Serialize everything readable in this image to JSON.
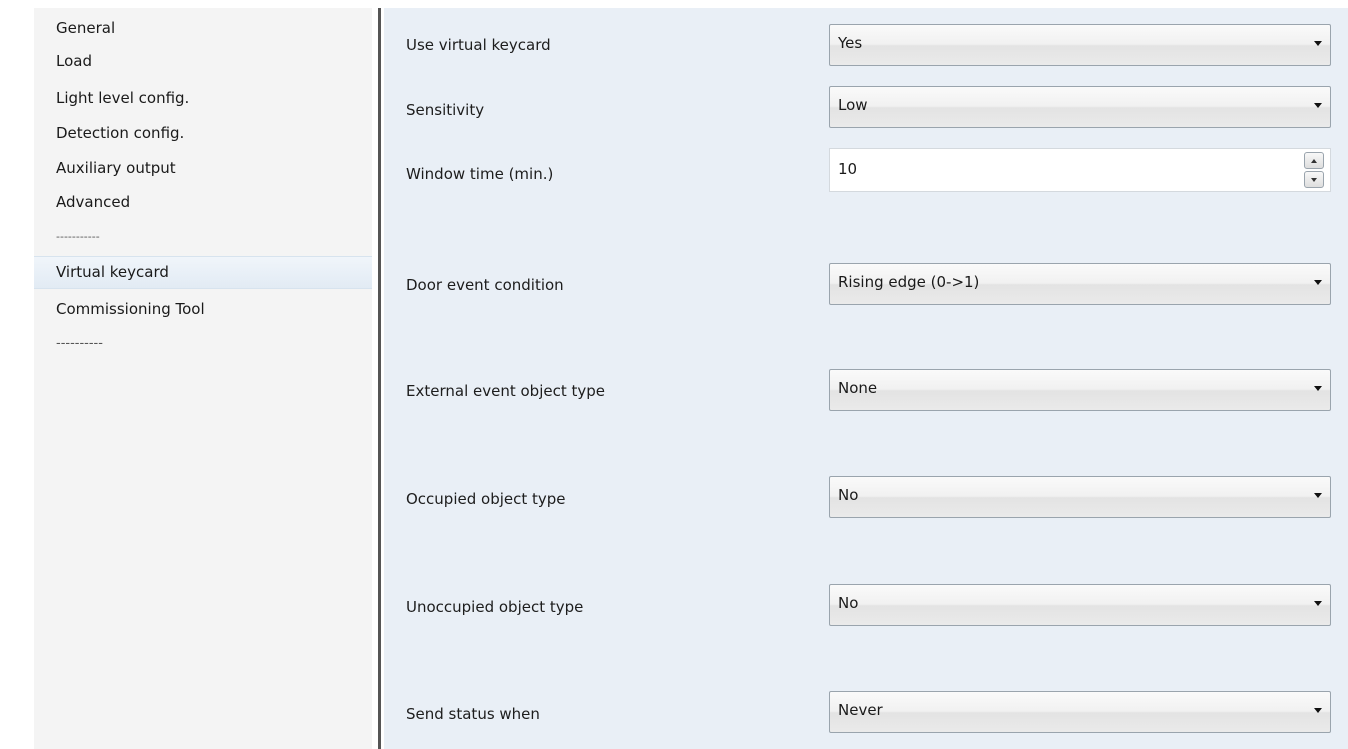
{
  "sidebar": {
    "items": [
      {
        "label": "General"
      },
      {
        "label": "Load"
      },
      {
        "label": "Light level config."
      },
      {
        "label": "Detection config."
      },
      {
        "label": "Auxiliary output"
      },
      {
        "label": "Advanced"
      },
      {
        "label": "-----------"
      },
      {
        "label": "Virtual keycard"
      },
      {
        "label": "Commissioning Tool"
      },
      {
        "label": "----------"
      }
    ],
    "selected_index": 7
  },
  "settings": {
    "use_virtual_keycard": {
      "label": "Use virtual keycard",
      "value": "Yes"
    },
    "sensitivity": {
      "label": "Sensitivity",
      "value": "Low"
    },
    "window_time": {
      "label": "Window time (min.)",
      "value": "10"
    },
    "door_event_condition": {
      "label": "Door event condition",
      "value": "Rising edge (0->1)"
    },
    "external_event_object_type": {
      "label": "External event object type",
      "value": "None"
    },
    "occupied_object_type": {
      "label": "Occupied object type",
      "value": "No"
    },
    "unoccupied_object_type": {
      "label": "Unoccupied object type",
      "value": "No"
    },
    "send_status_when": {
      "label": "Send status when",
      "value": "Never"
    }
  },
  "icons": {
    "dropdown": "chevron-down-icon",
    "spin_up": "spin-up-icon",
    "spin_down": "spin-down-icon"
  },
  "colors": {
    "panel_background": "#e9eff6",
    "sidebar_background": "#f4f4f4",
    "selection_background": "#e2ebf4"
  }
}
